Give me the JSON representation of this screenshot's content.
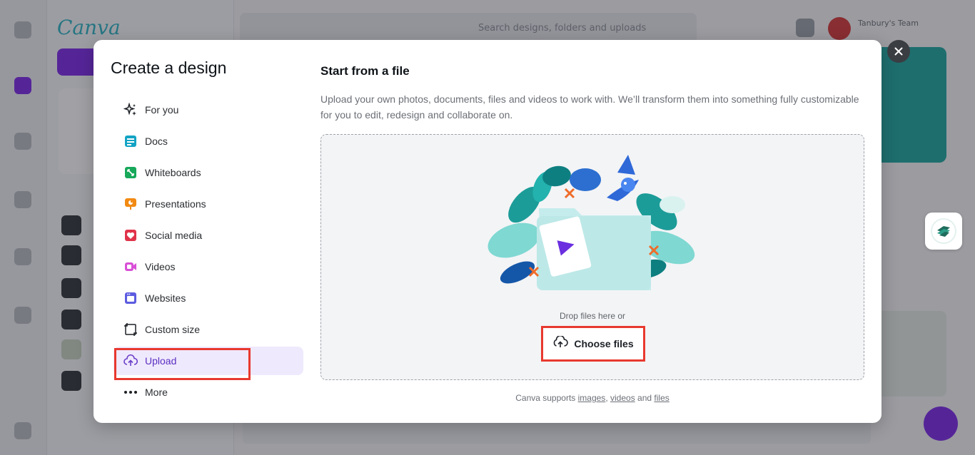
{
  "background": {
    "search_placeholder": "Search designs, folders and uploads",
    "user_name": "Tanbury's Team"
  },
  "modal": {
    "title": "Create a design",
    "close_icon": "close-icon",
    "menu": [
      {
        "label": "For you",
        "icon": "sparkle-icon",
        "color": "#1d2126"
      },
      {
        "label": "Docs",
        "icon": "docs-icon",
        "color": "#13a3c4"
      },
      {
        "label": "Whiteboards",
        "icon": "whiteboard-icon",
        "color": "#17a85a"
      },
      {
        "label": "Presentations",
        "icon": "presentation-icon",
        "color": "#f28a12"
      },
      {
        "label": "Social media",
        "icon": "heart-icon",
        "color": "#e0334a"
      },
      {
        "label": "Videos",
        "icon": "video-icon",
        "color": "#d94fd6"
      },
      {
        "label": "Websites",
        "icon": "website-icon",
        "color": "#5c5ce0"
      },
      {
        "label": "Custom size",
        "icon": "custom-size-icon",
        "color": "#1d2126"
      },
      {
        "label": "Upload",
        "icon": "upload-cloud-icon",
        "color": "#6a3fc8",
        "active": true
      },
      {
        "label": "More",
        "icon": "more-dots-icon",
        "color": "#1d2126"
      }
    ],
    "content": {
      "title": "Start from a file",
      "description": "Upload your own photos, documents, files and videos to work with. We’ll transform them into something fully customizable for you to edit, redesign and collaborate on.",
      "drop_text": "Drop files here or",
      "choose_button": "Choose files",
      "support_prefix": "Canva supports",
      "support_images": "images",
      "support_comma": ",",
      "support_videos": "videos",
      "support_and": "and",
      "support_files": "files"
    }
  },
  "colors": {
    "accent": "#7d2ae8",
    "highlight": "#e8392f",
    "active_bg": "#efe9fd"
  }
}
